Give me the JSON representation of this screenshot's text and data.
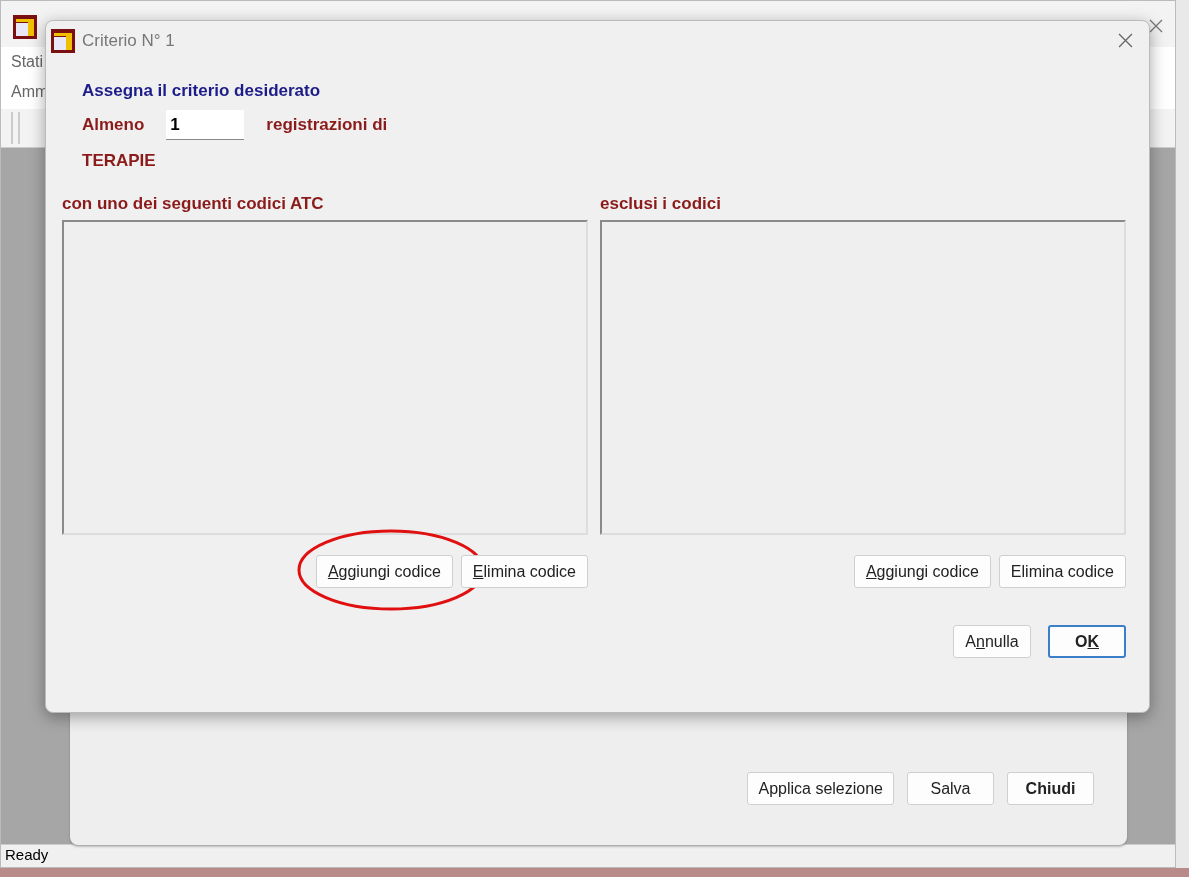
{
  "main_window": {
    "menu": [
      "Stati",
      "Amm"
    ],
    "status_bar": "Ready"
  },
  "dialog": {
    "title": "Criterio N° 1",
    "heading": "Assegna il criterio desiderato",
    "prefix": "Almeno",
    "count": "1",
    "suffix": "registrazioni di",
    "category": "TERAPIE",
    "lists": [
      {
        "label": "con uno dei seguenti codici ATC",
        "buttons": [
          {
            "key": "A",
            "after": "ggiungi codice",
            "highlighted": true
          },
          {
            "key": "E",
            "after": "limina codice",
            "highlighted": false
          }
        ]
      },
      {
        "label": "esclusi i codici",
        "buttons": [
          {
            "key": "A",
            "after": "ggiungi codice",
            "highlighted": false
          },
          {
            "before": "Elimina codice",
            "highlighted": false
          }
        ]
      }
    ],
    "actions": [
      {
        "before": "A",
        "key": "n",
        "after": "nulla",
        "default": false
      },
      {
        "before": "O",
        "key": "K",
        "default": true
      }
    ]
  },
  "child_window": {
    "buttons": [
      {
        "label": "Applica selezione",
        "default": false
      },
      {
        "label": "Salva",
        "default": false
      },
      {
        "label": "Chiudi",
        "default": true
      }
    ]
  }
}
